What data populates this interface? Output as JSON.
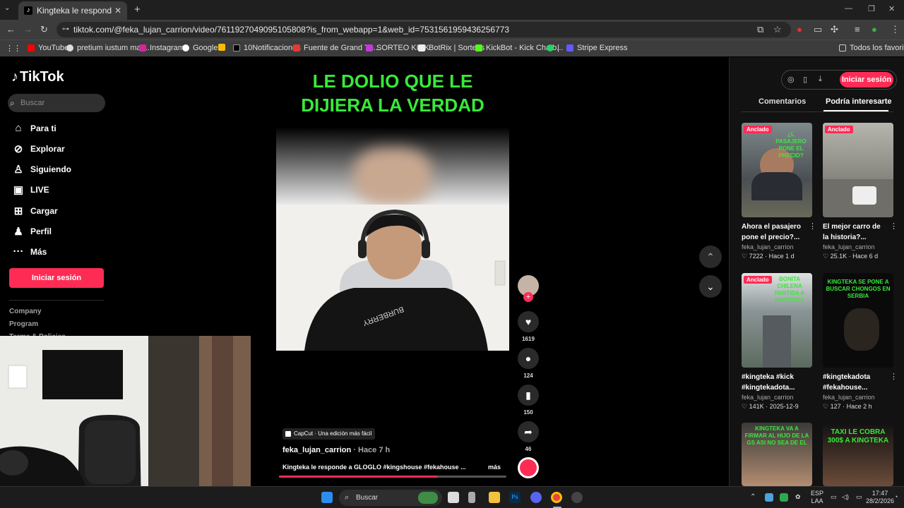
{
  "browser": {
    "tab_title": "Kingteka le responde a GLOGLO",
    "tab_close": "✕",
    "new_tab": "+",
    "url": "tiktok.com/@feka_lujan_carrion/video/7611927049095105808?is_from_webapp=1&web_id=7531561959436256773",
    "bookmarks": [
      "YouTube",
      "pretium iustum mat...",
      "Instagram",
      "Google",
      "",
      "10Notificaciones",
      "Fuente de Grand Th...",
      "SORTEO KICK",
      "BotRix | Sorteos",
      "KickBot - Kick Chatb...",
      "|",
      "Stripe Express"
    ],
    "all_bookmarks": "Todos los favoritos"
  },
  "sidebar": {
    "logo": "TikTok",
    "search_placeholder": "Buscar",
    "nav": [
      {
        "label": "Para ti",
        "icon": "home-icon"
      },
      {
        "label": "Explorar",
        "icon": "compass-icon"
      },
      {
        "label": "Siguiendo",
        "icon": "following-icon"
      },
      {
        "label": "LIVE",
        "icon": "live-icon"
      },
      {
        "label": "Cargar",
        "icon": "upload-icon"
      },
      {
        "label": "Perfil",
        "icon": "profile-icon"
      },
      {
        "label": "Más",
        "icon": "more-icon"
      }
    ],
    "login": "Iniciar sesión",
    "footer": [
      "Company",
      "Program",
      "Terms & Policies"
    ]
  },
  "video": {
    "headline_1": "LE DOLIO QUE LE",
    "headline_2": "DIJIERA LA VERDAD",
    "capcut": "CapCut · Una edición más fácil",
    "author": "feka_lujan_carrion",
    "time": " · Hace 7 h",
    "description": "Kingteka le responde a GLOGLO #kingshouse #fekahouse ...",
    "more": "más",
    "progress": 0.7
  },
  "actions": {
    "likes": "1619",
    "comments": "124",
    "saves": "150",
    "shares": "46"
  },
  "right_panel": {
    "login": "Iniciar sesión",
    "tab_comments": "Comentarios",
    "tab_interest": "Podría interesarte",
    "cards": [
      {
        "pinned": "Anclado",
        "caption": "¿L PASAJERO PONE EL PRECIO?",
        "title_1": "Ahora el pasajero",
        "title_2": "pone el precio?...",
        "user": "feka_lujan_carrion",
        "meta": "♡ 7222 · Hace 1 d"
      },
      {
        "pinned": "Anclado",
        "caption": "",
        "title_1": "El mejor carro de",
        "title_2": "la historia?...",
        "user": "feka_lujan_carrion",
        "meta": "♡ 25.1K · Hace 6 d"
      },
      {
        "pinned": "Anclado",
        "caption": "BONITA CHILENA PARTIDA A KINGTEKA",
        "title_1": "#kingteka #kick",
        "title_2": "#kingtekadota...",
        "user": "feka_lujan_carrion",
        "meta": "♡ 141K · 2025-12-9"
      },
      {
        "pinned": "",
        "caption": "KINGTEKA SE PONE A BUSCAR CHONGOS EN SERBIA",
        "title_1": "#kingtekadota",
        "title_2": "#fekahouse...",
        "user": "feka_lujan_carrion",
        "meta": "♡ 127 · Hace 2 h"
      },
      {
        "pinned": "",
        "caption": "KINGTEKA VA A FIRMAR AL HIJO DE LA GS ASI NO SEA DE EL",
        "title_1": "",
        "title_2": "",
        "user": "",
        "meta": ""
      },
      {
        "pinned": "",
        "caption": "TAXI LE COBRA 300$ A KINGTEKA",
        "title_1": "",
        "title_2": "",
        "user": "",
        "meta": ""
      }
    ]
  },
  "taskbar": {
    "search": "Buscar",
    "lang_1": "ESP",
    "lang_2": "LAA",
    "time": "17:47",
    "date": "28/2/2026"
  }
}
